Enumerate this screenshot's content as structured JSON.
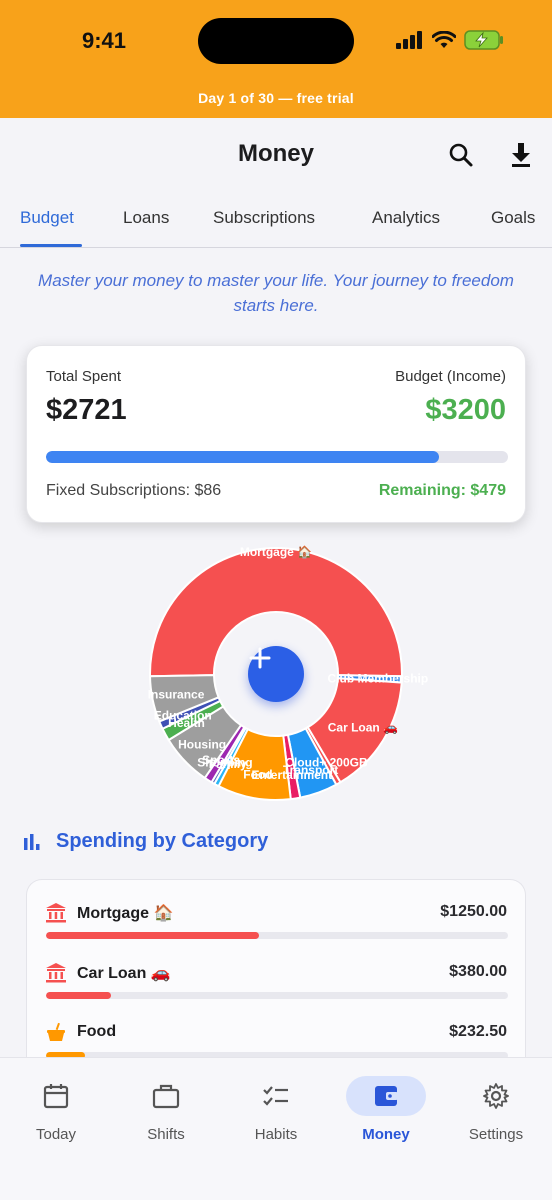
{
  "status_bar": {
    "time": "9:41",
    "trial_banner": "Day 1 of 30 — free trial"
  },
  "header": {
    "title": "Money",
    "icons": [
      "search-icon",
      "download-icon"
    ]
  },
  "tabs": [
    {
      "label": "Budget",
      "active": true
    },
    {
      "label": "Loans",
      "active": false
    },
    {
      "label": "Subscriptions",
      "active": false
    },
    {
      "label": "Analytics",
      "active": false
    },
    {
      "label": "Goals",
      "active": false
    }
  ],
  "tagline": "Master your money to master your life. Your journey to freedom starts here.",
  "summary": {
    "total_spent_label": "Total Spent",
    "total_spent_value": "$2721",
    "budget_label": "Budget (Income)",
    "budget_value": "$3200",
    "progress_fraction": 0.85,
    "fixed_subs": "Fixed Subscriptions: $86",
    "remaining": "Remaining: $479",
    "colors": {
      "spent_bar": "#3e84f2",
      "budget": "#4caf50",
      "remaining": "#4caf50"
    }
  },
  "donut": {
    "slices": [
      {
        "label": "Mortgage 🏠",
        "value": 1250,
        "color": "#f55050"
      },
      {
        "label": "Club Membership",
        "value": 20,
        "color": "#2f87e8"
      },
      {
        "label": "Car Loan 🚗",
        "value": 380,
        "color": "#f55050"
      },
      {
        "label": "Cloud+ 200GB",
        "value": 15,
        "color": "#f55050"
      },
      {
        "label": "Transport",
        "value": 120,
        "color": "#2196f3"
      },
      {
        "label": "Entertainment",
        "value": 30,
        "color": "#e91e63"
      },
      {
        "label": "Food",
        "value": 232.5,
        "color": "#ff9800"
      },
      {
        "label": "Family",
        "value": 15,
        "color": "#29b6f6"
      },
      {
        "label": "Shopping",
        "value": 10,
        "color": "#5c6bc0"
      },
      {
        "label": "Sports",
        "value": 25,
        "color": "#9c27b0"
      },
      {
        "label": "Housing",
        "value": 165,
        "color": "#9e9e9e"
      },
      {
        "label": "Health",
        "value": 40,
        "color": "#4caf50"
      },
      {
        "label": "Education",
        "value": 25,
        "color": "#3f51b5"
      },
      {
        "label": "Insurance",
        "value": 145,
        "color": "#9e9e9e"
      }
    ],
    "visible_labels": [
      "Mortgage 🏠",
      "Club Membership",
      "Car Loan 🚗",
      "Cloud+ 200GB",
      "Transport",
      "Entertainment",
      "Food",
      "Family",
      "Shopping",
      "Sports",
      "Housing",
      "Health",
      "Education",
      "Insurance"
    ]
  },
  "fab_icon": "plus-icon",
  "section": {
    "title": "Spending by Category",
    "icon": "bar-chart-icon"
  },
  "categories": [
    {
      "name": "Mortgage 🏠",
      "amount": "$1250.00",
      "fraction": 0.46,
      "color": "#f55050",
      "icon": "bank-icon"
    },
    {
      "name": "Car Loan 🚗",
      "amount": "$380.00",
      "fraction": 0.14,
      "color": "#f55050",
      "icon": "bank-icon"
    },
    {
      "name": "Food",
      "amount": "$232.50",
      "fraction": 0.085,
      "color": "#ff9800",
      "icon": "food-icon"
    }
  ],
  "bottom_nav": [
    {
      "label": "Today",
      "icon": "calendar-icon",
      "active": false
    },
    {
      "label": "Shifts",
      "icon": "briefcase-icon",
      "active": false
    },
    {
      "label": "Habits",
      "icon": "checklist-icon",
      "active": false
    },
    {
      "label": "Money",
      "icon": "wallet-icon",
      "active": true
    },
    {
      "label": "Settings",
      "icon": "gear-icon",
      "active": false
    }
  ]
}
